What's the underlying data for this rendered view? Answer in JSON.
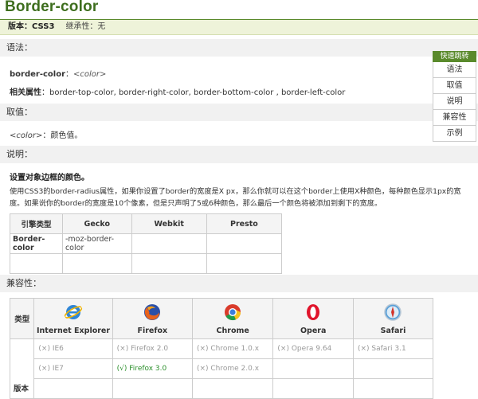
{
  "page": {
    "title": "Border-color"
  },
  "version_bar": {
    "version_label": "版本：CSS3",
    "inherit_label": "继承性：无"
  },
  "syntax": {
    "heading": "语法：",
    "property": "border-color",
    "colon": "：",
    "value": "<color>",
    "related_label": "相关属性",
    "related_text": "：border-top-color, border-right-color, border-bottom-color , border-left-color"
  },
  "values": {
    "heading": "取值：",
    "term": "<color>",
    "desc": "：颜色值。"
  },
  "description": {
    "heading": "说明：",
    "title": "设置对象边框的颜色。",
    "line1": "使用CSS3的border-radius属性，如果你设置了border的宽度是X px，那么你就可以在这个border上使用X种颜色，每种颜色显示1px的宽",
    "line2": "度。如果说你的border的宽度是10个像素，但是只声明了5或6种颜色，那么最后一个颜色将被添加到剩下的宽度。"
  },
  "engine_table": {
    "headers": [
      "引擎类型",
      "Gecko",
      "Webkit",
      "Presto"
    ],
    "row_label": "Border-color",
    "gecko_value": "-moz-border-color"
  },
  "quick_nav": {
    "title": "快速跳转",
    "items": [
      "语法",
      "取值",
      "说明",
      "兼容性",
      "示例"
    ]
  },
  "compat": {
    "heading": "兼容性：",
    "type_label": "类型",
    "version_label": "版本",
    "browsers": [
      "Internet Explorer",
      "Firefox",
      "Chrome",
      "Opera",
      "Safari"
    ],
    "row1": [
      "(×) IE6",
      "(×) Firefox 2.0",
      "(×) Chrome 1.0.x",
      "(×) Opera 9.64",
      "(×) Safari 3.1"
    ],
    "row2": [
      "(×) IE7",
      "(√) Firefox 3.0",
      "(×) Chrome 2.0.x",
      "",
      ""
    ]
  },
  "colors": {
    "accent": "#5a8a2c",
    "title": "#3e6e1e",
    "supported": "#2a8f2a",
    "unsupported": "#999999"
  }
}
